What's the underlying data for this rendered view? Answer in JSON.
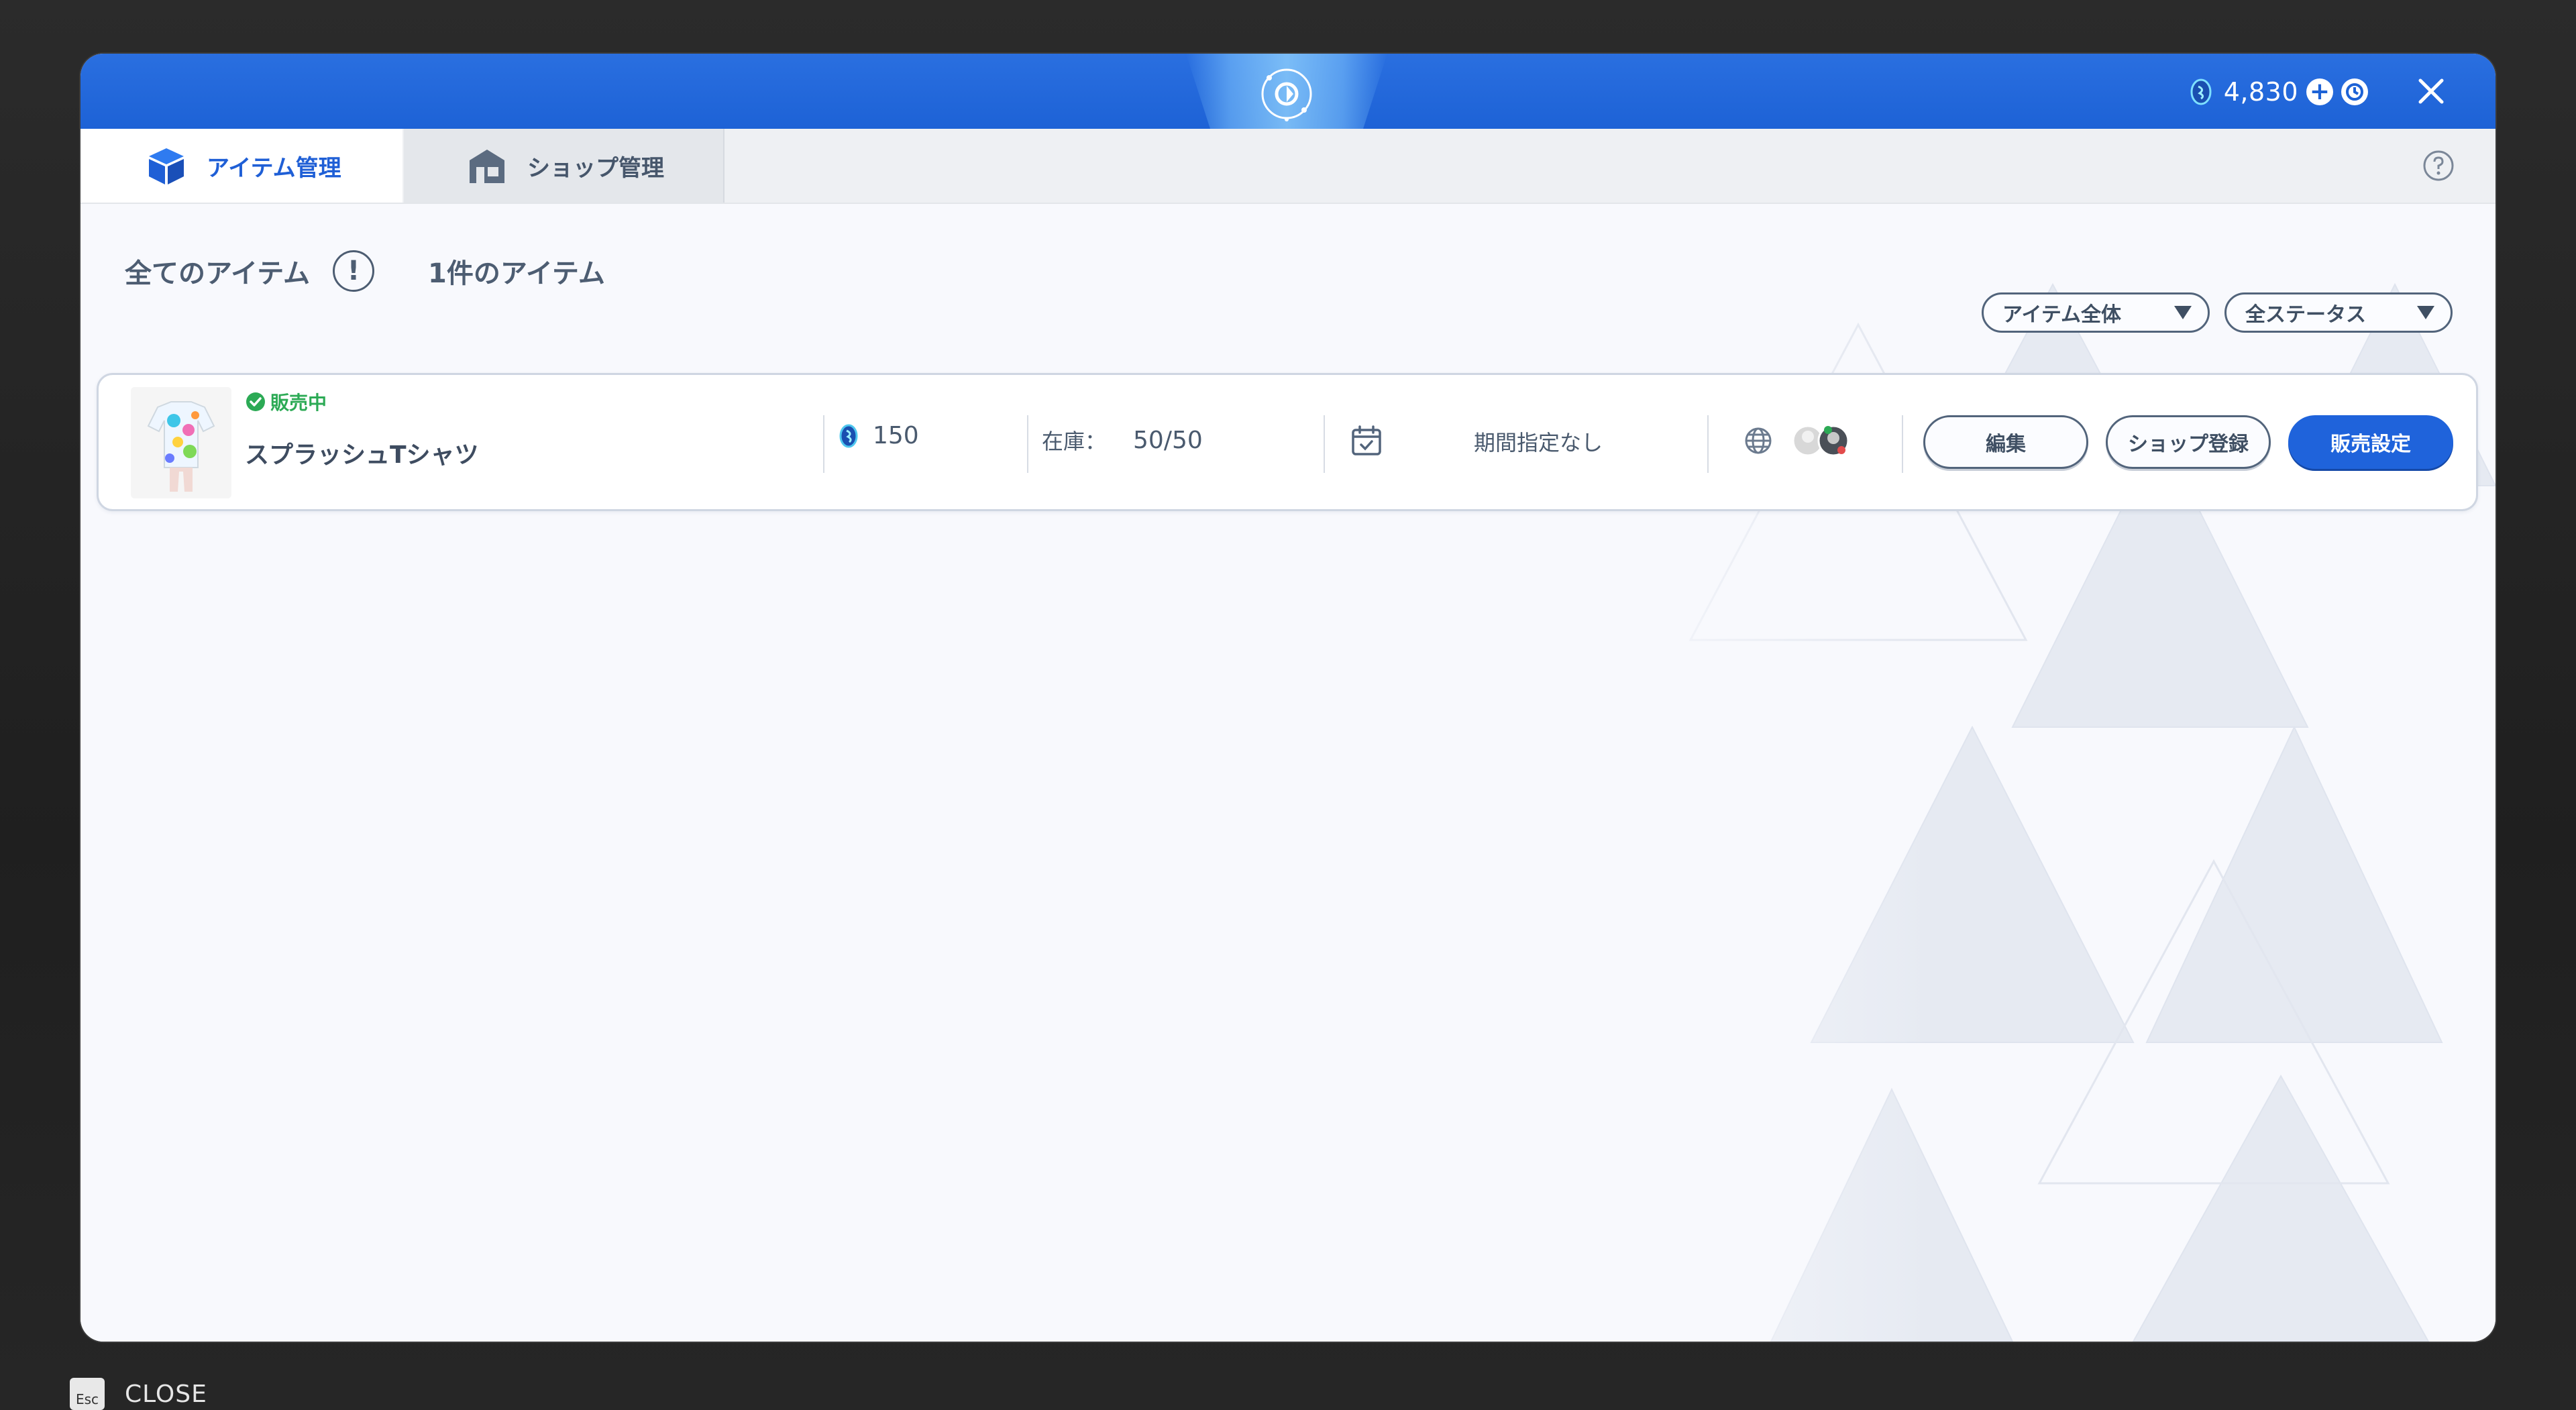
{
  "header": {
    "currency_amount": "4,830",
    "icons": [
      "app-logo-icon",
      "coin-icon",
      "add-currency-icon",
      "history-icon",
      "close-icon"
    ],
    "accent_color": "#1d62d6"
  },
  "tabs": [
    {
      "label": "アイテム管理",
      "icon": "cube-icon",
      "active": true
    },
    {
      "label": "ショップ管理",
      "icon": "shop-icon",
      "active": false
    }
  ],
  "toolbar": {
    "title": "全てのアイテム",
    "count_label": "1件のアイテム",
    "filter_category": "アイテム全体",
    "filter_status": "全ステータス"
  },
  "items": [
    {
      "status": "販売中",
      "status_color": "#2caa55",
      "name": "スプラッシュTシャツ",
      "price": "150",
      "stock_label": "在庫：",
      "stock_value": "50/50",
      "period": "期間指定なし",
      "buttons": {
        "edit": "編集",
        "shop_register": "ショップ登録",
        "sale_settings": "販売設定"
      }
    }
  ],
  "footer": {
    "esc_key": "Esc",
    "close_label": "CLOSE"
  }
}
